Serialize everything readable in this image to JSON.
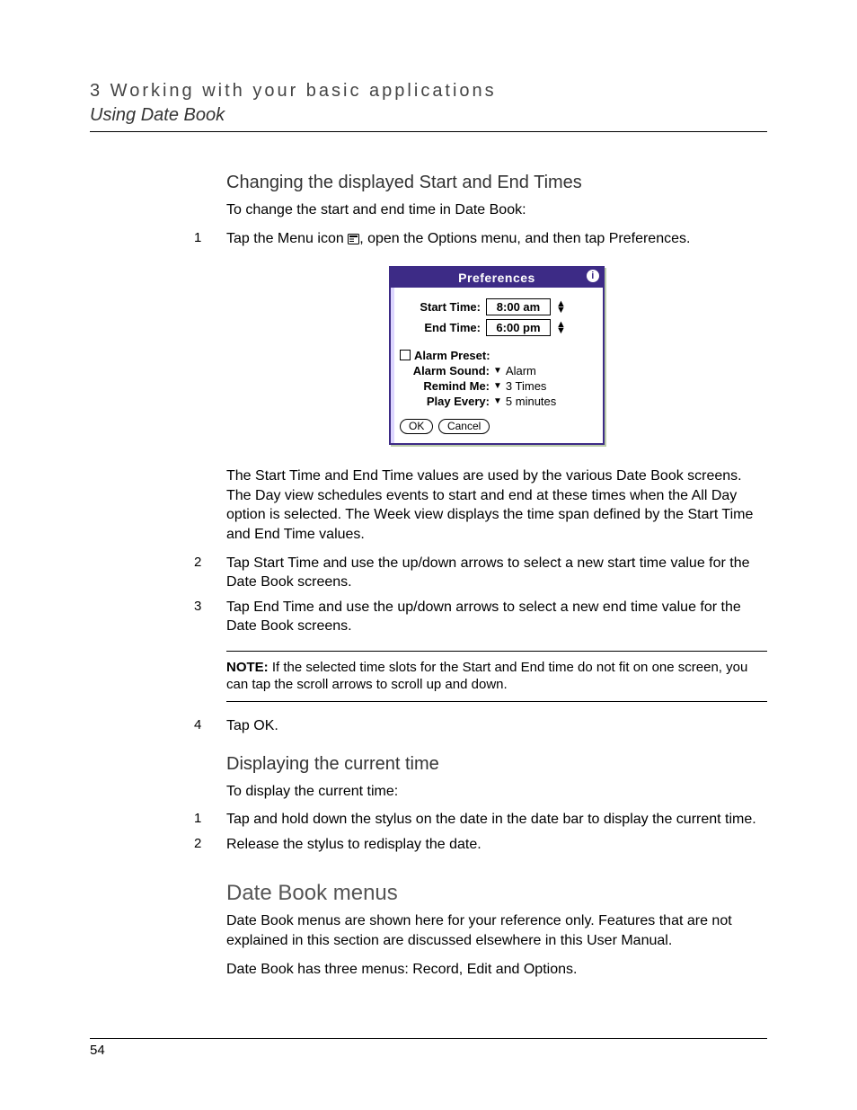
{
  "header": {
    "chapter": "3 Working with your basic applications",
    "section": "Using Date Book"
  },
  "section1": {
    "heading": "Changing the displayed Start and End Times",
    "intro": "To change the start and end time in Date Book:",
    "step1_num": "1",
    "step1_a": "Tap the Menu icon ",
    "step1_b": ", open the Options menu, and then tap Preferences.",
    "after_screenshot": "The Start Time and End Time values are used by the various Date Book screens. The Day view schedules events to start and end at these times when the All Day option is selected. The Week view displays the time span defined by the Start Time and End Time values.",
    "step2_num": "2",
    "step2": "Tap Start Time and use the up/down arrows to select a new start time value for the Date Book screens.",
    "step3_num": "3",
    "step3": "Tap End Time and use the up/down arrows to select a new end time value for the Date Book screens.",
    "note_label": "NOTE:",
    "note_text": " If the selected time slots for the Start and End time do not fit on one screen, you can tap the scroll arrows to scroll up and down.",
    "step4_num": "4",
    "step4": "Tap OK."
  },
  "section2": {
    "heading": "Displaying the current time",
    "intro": "To display the current time:",
    "step1_num": "1",
    "step1": "Tap and hold down the stylus on the date in the date bar to display the current time.",
    "step2_num": "2",
    "step2": "Release the stylus to redisplay the date."
  },
  "section3": {
    "heading": "Date Book menus",
    "para1": "Date Book menus are shown here for your reference only. Features that are not explained in this section are discussed elsewhere in this User Manual.",
    "para2": "Date Book has three menus: Record, Edit and Options."
  },
  "palm": {
    "title": "Preferences",
    "info": "i",
    "start_label": "Start Time:",
    "start_value": "8:00 am",
    "end_label": "End Time:",
    "end_value": "6:00 pm",
    "alarm_preset": "Alarm Preset:",
    "alarm_sound_label": "Alarm Sound:",
    "alarm_sound_value": "Alarm",
    "remind_label": "Remind Me:",
    "remind_value": "3 Times",
    "play_label": "Play Every:",
    "play_value": "5 minutes",
    "ok": "OK",
    "cancel": "Cancel"
  },
  "page_number": "54"
}
